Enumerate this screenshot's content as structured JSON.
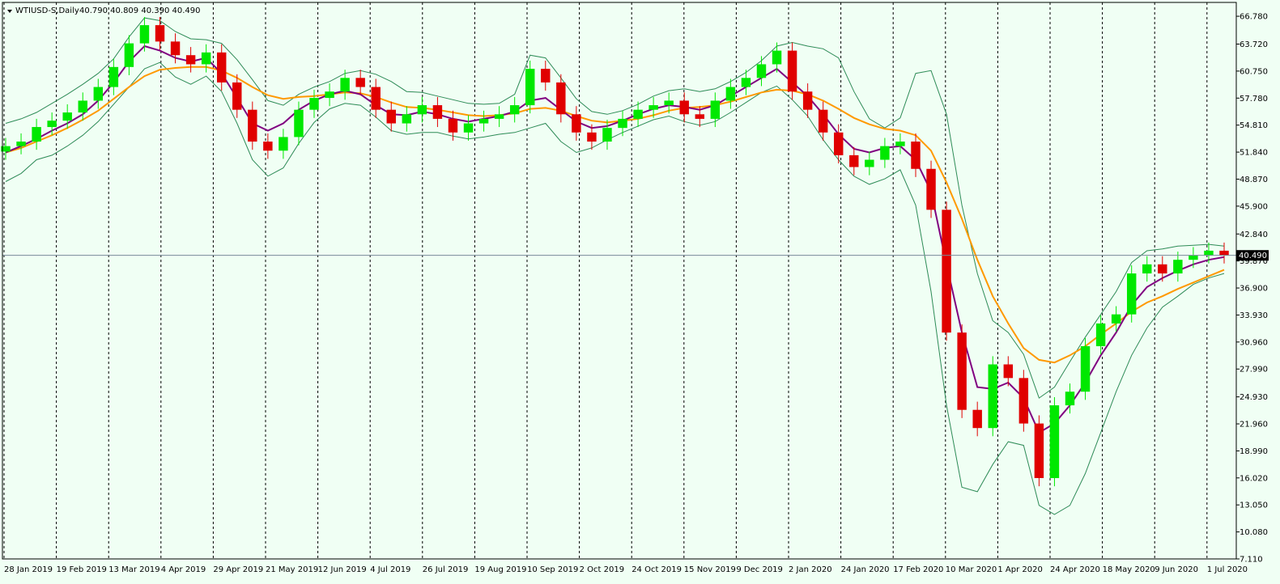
{
  "header": {
    "symbol": "WTIUSD-S,Daily",
    "ohlc": "40.790 40.809 40.390 40.490"
  },
  "colors": {
    "background": "#f0fff4",
    "bull": "#00e800",
    "bear": "#e00000",
    "ma_fast": "#800080",
    "ma_slow": "#ff9900",
    "bands": "#2e8b57",
    "price_line": "#7a8a9a",
    "grid": "#000000"
  },
  "chart_data": {
    "type": "candlestick",
    "instrument": "WTIUSD-S",
    "timeframe": "Daily",
    "last_price": "40.490",
    "ylim": [
      7.11,
      68.3
    ],
    "y_ticks": [
      "66.780",
      "63.720",
      "60.750",
      "57.780",
      "54.810",
      "51.840",
      "48.870",
      "45.900",
      "42.840",
      "39.870",
      "36.900",
      "33.930",
      "30.960",
      "27.990",
      "24.930",
      "21.960",
      "18.990",
      "16.020",
      "13.050",
      "10.080",
      "7.110"
    ],
    "x_ticks": [
      "28 Jan 2019",
      "19 Feb 2019",
      "13 Mar 2019",
      "4 Apr 2019",
      "29 Apr 2019",
      "21 May 2019",
      "12 Jun 2019",
      "4 Jul 2019",
      "26 Jul 2019",
      "19 Aug 2019",
      "10 Sep 2019",
      "2 Oct 2019",
      "24 Oct 2019",
      "15 Nov 2019",
      "9 Dec 2019",
      "2 Jan 2020",
      "24 Jan 2020",
      "17 Feb 2020",
      "10 Mar 2020",
      "1 Apr 2020",
      "24 Apr 2020",
      "18 May 2020",
      "9 Jun 2020",
      "1 Jul 2020"
    ],
    "series": [
      {
        "values": [
          52.5,
          53.0,
          54.6,
          55.3,
          56.2,
          57.5,
          59.0,
          61.2,
          63.8,
          65.8,
          64.0,
          62.5,
          61.5,
          62.8,
          59.5,
          56.5,
          53.0,
          52.0,
          53.5,
          56.5,
          57.8,
          58.5,
          60.0,
          59.0,
          56.5,
          55.0,
          56.0,
          57.0,
          55.5,
          54.0,
          55.0,
          55.5,
          56.0,
          57.0,
          61.0,
          59.5,
          56.0,
          54.0,
          53.0,
          54.5,
          55.5,
          56.5,
          57.0,
          57.5,
          56.0,
          55.5,
          57.5,
          59.0,
          60.0,
          61.5,
          63.0,
          58.5,
          56.5,
          54.0,
          51.5,
          50.2,
          51.0,
          52.5,
          53.0,
          50.0,
          45.5,
          32.0,
          23.5,
          21.5,
          28.5,
          27.0,
          22.0,
          16.0,
          24.0,
          25.5,
          30.5,
          33.0,
          34.0,
          38.5,
          39.5,
          38.5,
          40.0,
          40.5,
          41.0,
          40.5
        ]
      },
      {
        "values": [
          52.5,
          53.0,
          54.6,
          55.3,
          56.2,
          57.5,
          59.0,
          61.2,
          63.8,
          65.8,
          64.0,
          62.5,
          61.5,
          62.8,
          59.5,
          56.5,
          53.0,
          52.0,
          53.5,
          56.5,
          57.8,
          58.5,
          60.0,
          59.0,
          56.5,
          55.0,
          56.0,
          57.0,
          55.5,
          54.0,
          55.0,
          55.5,
          56.0,
          57.0,
          61.0,
          59.5,
          56.0,
          54.0,
          53.0,
          54.5,
          55.5,
          56.5,
          57.0,
          57.5,
          56.0,
          55.5,
          57.5,
          59.0,
          60.0,
          61.5,
          63.0,
          58.5,
          56.5,
          54.0,
          51.5,
          50.2,
          51.0,
          52.5,
          53.0,
          50.0,
          45.5,
          32.0,
          23.5,
          21.5,
          28.5,
          27.0,
          22.0,
          16.0,
          24.0,
          25.5,
          30.5,
          33.0,
          34.0,
          38.5,
          39.5,
          38.5,
          40.0,
          40.5,
          41.0,
          40.5
        ]
      },
      {
        "values": [
          51.8,
          52.5,
          53.3,
          54.2,
          55.0,
          56.0,
          57.5,
          59.5,
          61.8,
          63.5,
          63.0,
          62.2,
          61.8,
          62.2,
          60.5,
          57.8,
          55.0,
          54.2,
          55.0,
          56.5,
          57.5,
          58.2,
          58.6,
          58.2,
          57.0,
          56.0,
          55.9,
          56.3,
          56.0,
          55.5,
          55.2,
          55.5,
          55.8,
          56.3,
          57.5,
          57.8,
          56.5,
          55.2,
          54.5,
          54.7,
          55.3,
          56.0,
          56.6,
          57.0,
          56.8,
          56.5,
          57.0,
          58.0,
          59.0,
          60.0,
          61.0,
          59.5,
          58.0,
          56.0,
          53.8,
          52.2,
          51.8,
          52.3,
          52.5,
          51.0,
          47.5,
          39.5,
          32.0,
          26.0,
          25.8,
          26.5,
          24.8,
          21.0,
          22.0,
          24.0,
          26.5,
          29.5,
          32.0,
          35.0,
          37.0,
          38.0,
          38.8,
          39.5,
          40.0,
          40.3
        ]
      },
      {
        "values": [
          51.8,
          52.3,
          53.0,
          53.7,
          54.5,
          55.4,
          56.4,
          57.7,
          59.0,
          60.2,
          60.9,
          61.1,
          61.2,
          61.2,
          60.8,
          60.0,
          59.0,
          58.1,
          57.7,
          57.9,
          58.0,
          58.2,
          58.4,
          58.3,
          57.9,
          57.3,
          56.8,
          56.7,
          56.5,
          56.2,
          55.9,
          55.8,
          55.9,
          56.1,
          56.6,
          56.7,
          56.4,
          55.8,
          55.3,
          55.1,
          55.3,
          55.5,
          55.9,
          56.4,
          56.7,
          56.8,
          57.0,
          57.4,
          57.9,
          58.4,
          58.7,
          58.6,
          58.2,
          57.5,
          56.6,
          55.6,
          54.9,
          54.4,
          54.2,
          53.7,
          52.0,
          48.5,
          44.5,
          40.0,
          36.0,
          33.0,
          30.3,
          29.0,
          28.7,
          29.5,
          30.5,
          31.8,
          33.0,
          34.3,
          35.3,
          36.0,
          36.8,
          37.5,
          38.2,
          38.9
        ]
      },
      {
        "values": [
          55.0,
          55.5,
          56.2,
          57.2,
          58.2,
          59.3,
          60.5,
          62.1,
          64.5,
          66.6,
          66.3,
          65.1,
          64.3,
          64.2,
          63.8,
          62.0,
          59.8,
          57.5,
          57.0,
          58.2,
          59.0,
          59.6,
          60.5,
          60.8,
          60.4,
          59.6,
          58.5,
          58.4,
          58.0,
          57.6,
          57.2,
          57.1,
          57.2,
          58.2,
          62.5,
          62.2,
          60.0,
          57.7,
          56.3,
          56.0,
          56.4,
          57.1,
          58.0,
          58.6,
          58.8,
          58.5,
          58.8,
          59.6,
          60.6,
          61.9,
          63.5,
          63.9,
          63.5,
          63.2,
          62.2,
          58.5,
          55.5,
          54.5,
          55.6,
          60.5,
          60.8,
          56.0,
          46.0,
          38.5,
          33.3,
          32.0,
          29.6,
          24.8,
          26.0,
          28.8,
          31.5,
          34.0,
          36.5,
          39.7,
          41.0,
          41.2,
          41.5,
          41.6,
          41.7,
          41.5
        ]
      },
      {
        "values": [
          48.6,
          49.5,
          51.0,
          51.5,
          52.5,
          53.7,
          55.2,
          57.1,
          59.0,
          61.0,
          61.7,
          60.1,
          59.3,
          60.2,
          58.5,
          55.0,
          51.0,
          49.2,
          50.1,
          52.8,
          55.1,
          56.6,
          57.2,
          57.0,
          55.7,
          54.2,
          53.8,
          54.0,
          54.0,
          53.6,
          53.3,
          53.5,
          53.8,
          54.0,
          54.5,
          55.0,
          53.0,
          51.8,
          52.3,
          53.2,
          54.0,
          54.7,
          55.4,
          55.8,
          55.2,
          54.8,
          55.2,
          56.2,
          57.3,
          58.4,
          59.1,
          57.6,
          55.8,
          53.2,
          51.0,
          49.2,
          48.3,
          48.9,
          49.9,
          46.0,
          36.5,
          24.0,
          15.0,
          14.5,
          17.5,
          20.0,
          19.6,
          13.0,
          12.0,
          13.0,
          16.5,
          21.0,
          25.5,
          29.5,
          32.5,
          34.8,
          36.0,
          37.3,
          38.0,
          38.5
        ]
      }
    ],
    "series_styles": [
      "bull",
      "bear",
      "ma_fast",
      "ma_slow",
      "bands",
      "bands"
    ],
    "price_line": 40.49,
    "grid": "vertical-dashed"
  }
}
